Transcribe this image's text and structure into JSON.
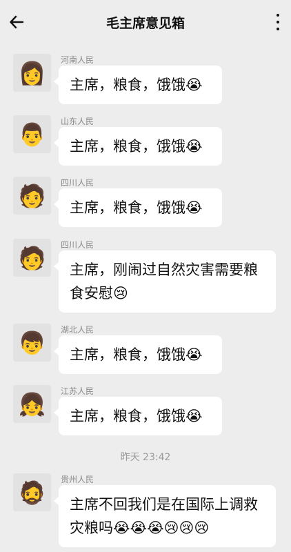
{
  "header": {
    "title": "毛主席意见箱",
    "back_icon": "arrow-left-icon",
    "more_icon": "more-vertical-icon"
  },
  "messages": [
    {
      "sender": "河南人民",
      "avatar": "👩",
      "text": "主席，粮食，饿饿😭"
    },
    {
      "sender": "山东人民",
      "avatar": "👨",
      "text": "主席，粮食，饿饿😭"
    },
    {
      "sender": "四川人民",
      "avatar": "🧑",
      "text": "主席，粮食，饿饿😭"
    },
    {
      "sender": "四川人民",
      "avatar": "🧑",
      "text": "主席，刚闹过自然灾害需要粮食安慰😢"
    },
    {
      "sender": "湖北人民",
      "avatar": "👦",
      "text": "主席，粮食，饿饿😭"
    },
    {
      "sender": "江苏人民",
      "avatar": "👧",
      "text": "主席，粮食，饿饿😭"
    },
    {
      "sender": "贵州人民",
      "avatar": "🧔",
      "text": "主席不回我们是在国际上调救灾粮吗😭😭😭😢😢😢"
    }
  ],
  "timestamp": "昨天 23:42"
}
